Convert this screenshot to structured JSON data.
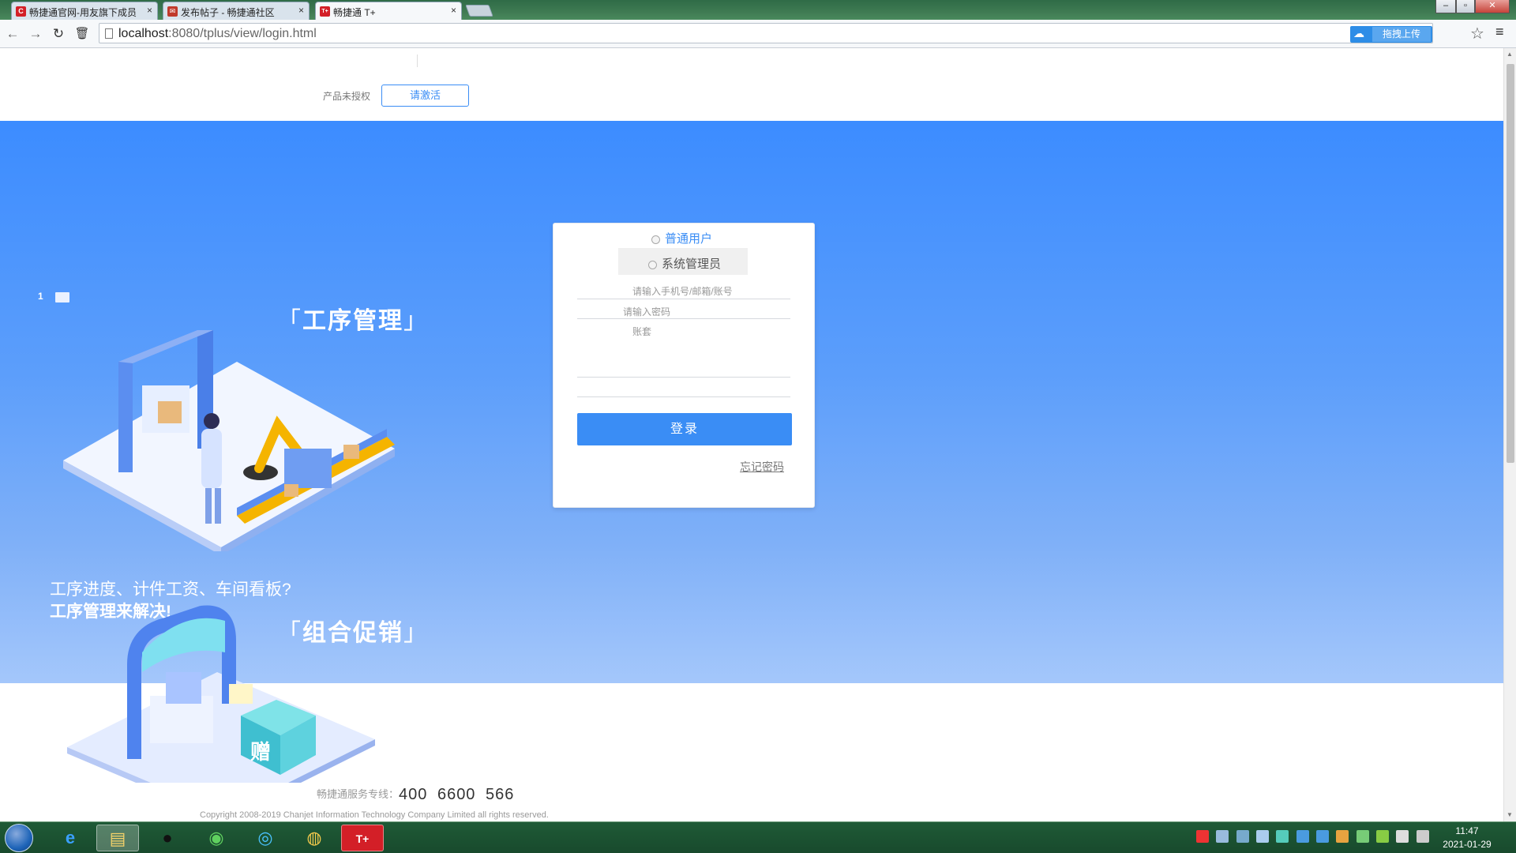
{
  "browser": {
    "tabs": [
      {
        "title": "畅捷通官网-用友旗下成员",
        "favicon": "C"
      },
      {
        "title": "发布帖子 - 畅捷通社区",
        "favicon": "✉"
      },
      {
        "title": "畅捷通 T+",
        "favicon": "T+"
      }
    ],
    "url_host": "localhost",
    "url_rest": ":8080/tplus/view/login.html",
    "upload_ext_label": "拖拽上传"
  },
  "header": {
    "unauthorized_text": "产品未授权",
    "activate_label": "请激活"
  },
  "hero": {
    "slider_indicator": "1",
    "feature1_title": "工序管理",
    "tagline_line1": "工序进度、计件工资、车间看板?",
    "tagline_line2": "工序管理来解决!",
    "feature2_title": "组合促销",
    "gift_char": "赠"
  },
  "login": {
    "user_type_label": "普通用户",
    "admin_type_label": "系统管理员",
    "account_placeholder": "请输入手机号/邮箱/账号",
    "password_placeholder": "请输入密码",
    "ledger_placeholder": "账套",
    "login_label": "登录",
    "forgot_label": "忘记密码"
  },
  "footer": {
    "hotline_label": "畅捷通服务专线：",
    "hotline_number": "400 6600 566",
    "copyright": "Copyright 2008-2019 Chanjet Information Technology Company Limited all rights reserved."
  },
  "taskbar": {
    "time": "11:47",
    "date": "2021-01-29"
  },
  "colors": {
    "accent": "#3a8df5",
    "hero_top": "#3c8cff",
    "hero_bottom": "#a4c7fb"
  }
}
